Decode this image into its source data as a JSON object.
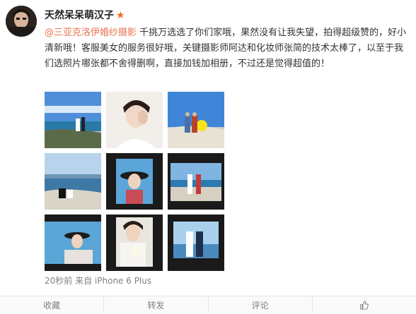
{
  "post": {
    "username": "天然呆呆萌汉子",
    "vip_icon": "★",
    "mention": "@三亚克洛伊婚纱摄影",
    "text": " 千挑万选选了你们家哦，果然没有让我失望，拍得超级赞的，好小清新哦！客服美女的服务很好哦，关键摄影师阿达和化妆师张简的技术太棒了，以至于我们选照片哪张都不舍得删啊，直接加钱加相册，不过还是觉得超值的！",
    "time": "20秒前",
    "source": "来自 iPhone 6 Plus"
  },
  "photos": [
    {
      "name": "beach-couple-photo"
    },
    {
      "name": "bride-portrait-photo"
    },
    {
      "name": "couple-balloons-photo"
    },
    {
      "name": "couple-rocks-photo"
    },
    {
      "name": "bride-hat-photo"
    },
    {
      "name": "couple-walking-photo"
    },
    {
      "name": "bride-sea-photo"
    },
    {
      "name": "bride-flowers-photo"
    },
    {
      "name": "couple-screen-photo"
    }
  ],
  "actions": {
    "favorite": "收藏",
    "repost": "转发",
    "comment": "评论",
    "like_icon": "thumbs-up-icon"
  },
  "colors": {
    "mention": "#eb7350",
    "vip": "#f06a1b"
  }
}
